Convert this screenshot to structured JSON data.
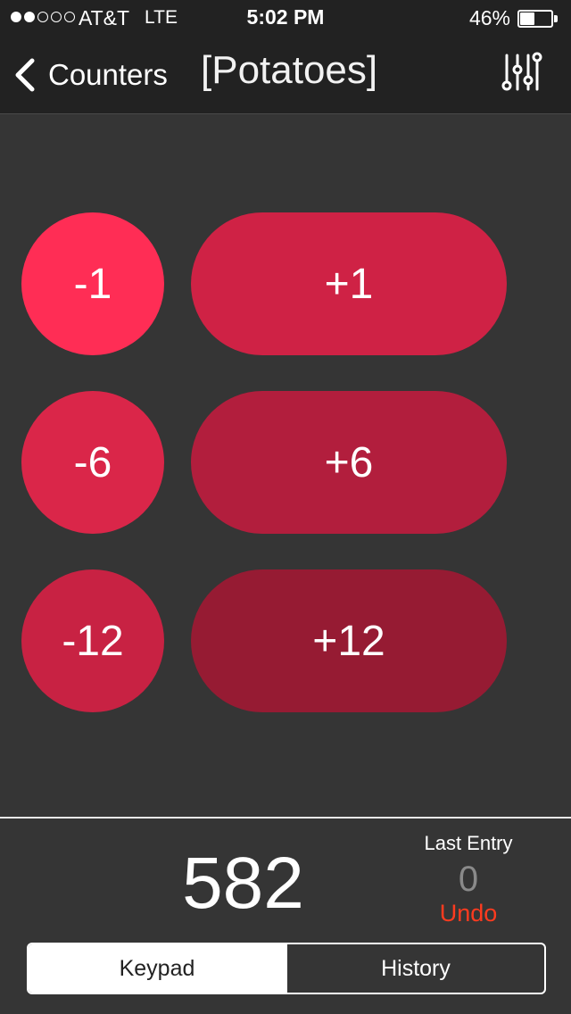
{
  "status_bar": {
    "carrier": "AT&T",
    "network": "LTE",
    "time": "5:02 PM",
    "battery_percent": "46%",
    "battery_level": 0.46,
    "signal_bars_filled": 2,
    "signal_bars_total": 5
  },
  "nav": {
    "back_label": "Counters",
    "title": "[Potatoes]",
    "back_icon": "chevron-left-icon",
    "settings_icon": "sliders-icon"
  },
  "keypad": {
    "rows": [
      {
        "minus_label": "-1",
        "plus_label": "+1",
        "minus_color": "#ff2d55",
        "plus_color": "#cf2245"
      },
      {
        "minus_label": "-6",
        "plus_label": "+6",
        "minus_color": "#da2649",
        "plus_color": "#b21e3d"
      },
      {
        "minus_label": "-12",
        "plus_label": "+12",
        "minus_color": "#c82243",
        "plus_color": "#961b33"
      }
    ]
  },
  "footer": {
    "count": "582",
    "last_entry_label": "Last Entry",
    "last_entry_value": "0",
    "undo_label": "Undo",
    "tabs": [
      {
        "label": "Keypad",
        "active": true
      },
      {
        "label": "History",
        "active": false
      }
    ]
  },
  "colors": {
    "background": "#353535",
    "header_bg": "#222222",
    "undo": "#ff3b1f"
  }
}
